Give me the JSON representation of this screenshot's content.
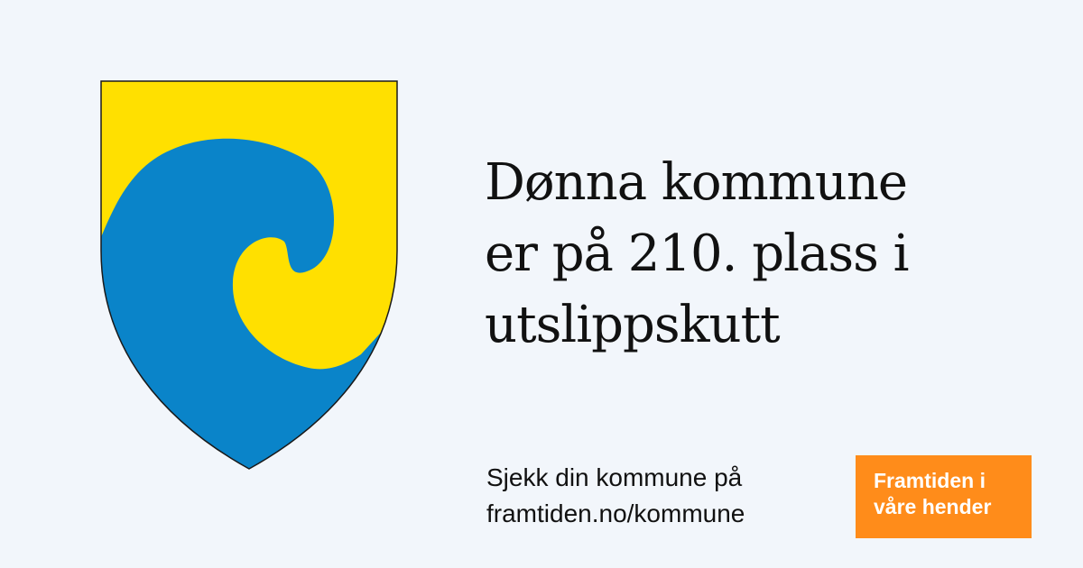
{
  "crest": {
    "icon": "municipal-coat-of-arms-wave",
    "colors": {
      "yellow": "#ffe000",
      "blue": "#0a84c9",
      "outline": "#1a1a1a"
    }
  },
  "headline": {
    "lines": [
      "Dønna kommune",
      "er på 210. plass i",
      "utslippskutt"
    ]
  },
  "cta": {
    "line1": "Sjekk din kommune på",
    "line2": "framtiden.no/kommune"
  },
  "badge": {
    "line1": "Framtiden i",
    "line2": "våre hender",
    "color": "#ff8c1a"
  },
  "colors": {
    "background": "#f2f6fb",
    "text": "#111111"
  }
}
